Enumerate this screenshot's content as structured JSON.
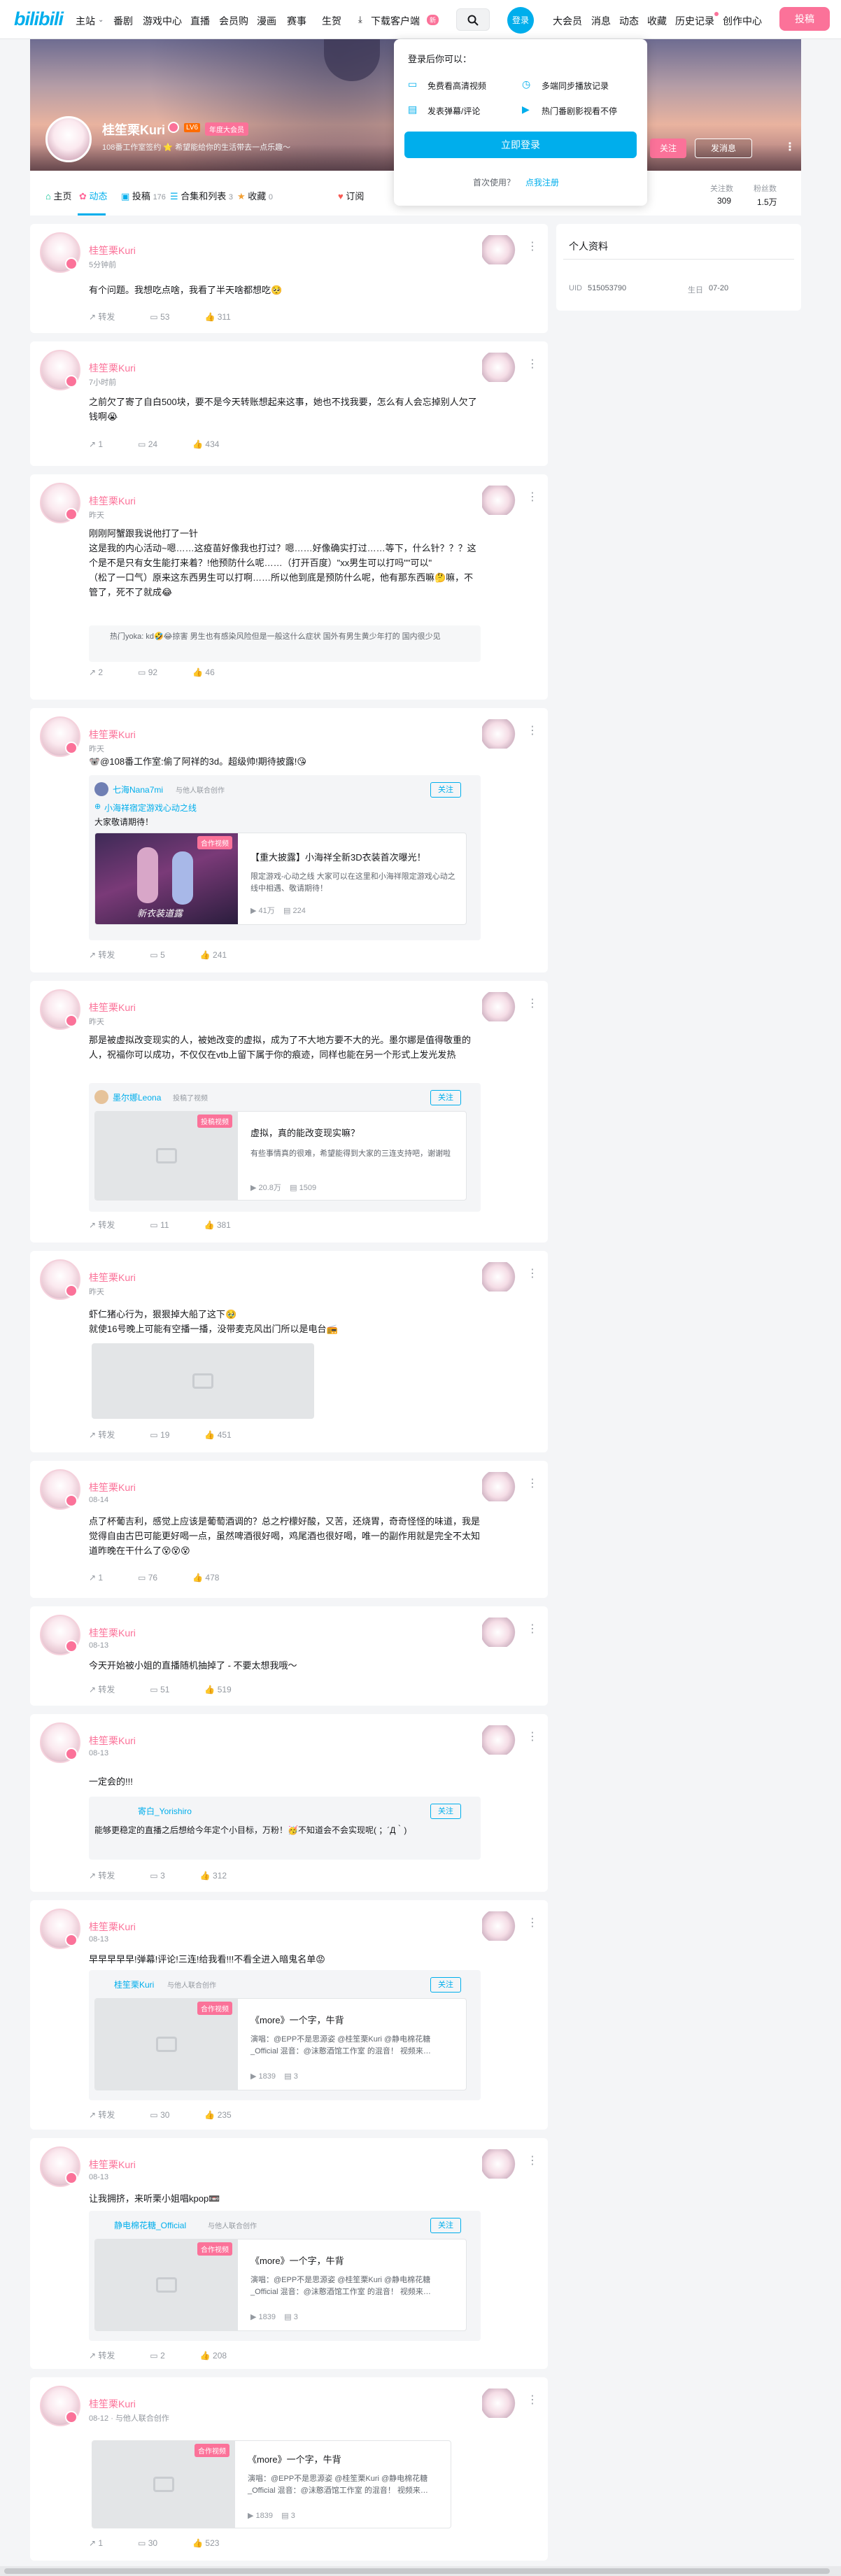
{
  "topbar": {
    "logo": "bilibili",
    "nav": [
      "主站",
      "番剧",
      "游戏中心",
      "直播",
      "会员购",
      "漫画",
      "赛事",
      "生贺",
      "下载客户端"
    ],
    "download_badge": "新",
    "login": "登录",
    "right": [
      "大会员",
      "消息",
      "动态",
      "收藏",
      "历史记录",
      "创作中心"
    ],
    "upload": "投稿"
  },
  "profile": {
    "name": "桂笙栗Kuri",
    "level": "LV6",
    "vip": "年度大会员",
    "sign": "108番工作室签约 ⭐ 希望能给你的生活带去一点乐趣～"
  },
  "popup": {
    "title": "登录后你可以：",
    "items": [
      "免费看高清视频",
      "多端同步播放记录",
      "发表弹幕/评论",
      "热门番剧影视看不停"
    ],
    "button": "立即登录",
    "first": "首次使用？",
    "register": "点我注册"
  },
  "banner": {
    "follow": "关注",
    "message": "发消息"
  },
  "tabs": {
    "home": "主页",
    "dynamic": "动态",
    "video": "投稿",
    "video_count": "176",
    "collect": "合集和列表",
    "collect_count": "3",
    "fav": "收藏",
    "fav_count": "0",
    "sub": "订阅"
  },
  "stats": {
    "follow_label": "关注数",
    "follow": "309",
    "fans_label": "粉丝数",
    "fans": "1.5万"
  },
  "side": {
    "title": "个人资料",
    "uid_label": "UID",
    "uid": "515053790",
    "birth_label": "生日",
    "birth": "07-20"
  },
  "posts": [
    {
      "name": "桂笙栗Kuri",
      "time": "5分钟前",
      "text": "有个问题。我想吃点啥，我看了半天啥都想吃🥺",
      "fwd": "转发",
      "cmt": "53",
      "like": "311"
    },
    {
      "name": "桂笙栗Kuri",
      "time": "7小时前",
      "text": "之前欠了寄了自白500块，要不是今天转账想起来这事，她也不找我要，怎么有人会忘掉别人欠了钱啊😭",
      "fwd": "1",
      "cmt": "24",
      "like": "434"
    },
    {
      "name": "桂笙栗Kuri",
      "time": "昨天",
      "text": "刚刚阿蟹跟我说他打了一针\n这是我的内心活动~嗯……这疫苗好像我也打过？嗯……好像确实打过……等下，什么针？？？这个是不是只有女生能打来着？!他预防什么呢……（打开百度）\"xx男生可以打吗\"\"可以\"\n（松了一口气）原来这东西男生可以打啊……所以他到底是预防什么呢，他有那东西嘛🤔嘛，不管了，死不了就成😂",
      "quote": "热门yoka: kd🤣😂掠害 男生也有感染风险但是一般这什么症状 国外有男生黄少年打的 国内很少见",
      "fwd": "2",
      "cmt": "92",
      "like": "46"
    },
    {
      "name": "桂笙栗Kuri",
      "time": "昨天",
      "text": "🐨@108番工作室:偷了阿祥的3d。超级帅!期待披露!😘",
      "card_user": "七海Nana7mi",
      "card_meta": "与他人联合创作",
      "topic": "小海祥宿定游戏心动之线",
      "card_text": "大家敬请期待！",
      "video_title": "【重大披露】小海祥全新3D衣装首次曝光！",
      "video_desc": "限定游戏-心动之线 大家可以在这里和小海祥限定游戏心动之线中相遇、敬请期待！",
      "video_views": "41万",
      "video_dm": "224",
      "cover_text": "新衣装道露",
      "video_badge": "合作视频",
      "fwd": "",
      "cmt": "5",
      "like": "241"
    },
    {
      "name": "桂笙栗Kuri",
      "time": "昨天",
      "text": "那是被虚拟改变现实的人，被她改变的虚拟，成为了不大地方要不大的光。墨尔娜是值得敬重的人，祝福你可以成功，不仅仅在vtb上留下属于你的痕迹，同样也能在另一个形式上发光发热",
      "card_user": "墨尔娜Leona",
      "card_meta": "投稿了视频",
      "video_title": "虚拟，真的能改变现实嘛？",
      "video_desc": "有些事情真的很难，希望能得到大家的三连支持吧，谢谢啦",
      "video_views": "20.8万",
      "video_dm": "1509",
      "video_badge": "投稿视频",
      "fwd": "",
      "cmt": "11",
      "like": "381"
    },
    {
      "name": "桂笙栗Kuri",
      "time": "昨天",
      "text": "虾仁猪心行为，狠狠掉大船了这下🥹\n就使16号晚上可能有空播一播，没带麦克风出门所以是电台📻",
      "fwd": "",
      "cmt": "19",
      "like": "451"
    },
    {
      "name": "桂笙栗Kuri",
      "time": "08-14",
      "text": "点了杯葡吉利，感觉上应该是葡萄酒调的？总之柠檬好酸，又苦，还烧胃，奇奇怪怪的味道，我是觉得自由古巴可能更好喝一点，虽然啤酒很好喝，鸡尾酒也很好喝，唯一的副作用就是完全不太知道昨晚在干什么了😵😵😵",
      "fwd": "1",
      "cmt": "76",
      "like": "478"
    },
    {
      "name": "桂笙栗Kuri",
      "time": "08-13",
      "text": "今天开始被小姐的直播随机抽掉了 - 不要太想我哦～",
      "fwd": "",
      "cmt": "51",
      "like": "519"
    },
    {
      "name": "桂笙栗Kuri",
      "time": "08-13",
      "text": "一定会的!!!",
      "card_user": "寄白_Yorishiro",
      "card_text": "能够更稳定的直播之后想给今年定个小目标，万粉！🥳不知道会不会实现呢( ；´Д｀)",
      "fwd": "",
      "cmt": "3",
      "like": "312"
    },
    {
      "name": "桂笙栗Kuri",
      "time": "08-13",
      "text": "早早早早早!弹幕!评论!三连!给我看!!!不看全进入暗鬼名单😡",
      "card_user": "桂笙栗Kuri",
      "card_meta": "与他人联合创作",
      "video_title": "《more》一个字，牛背",
      "video_desc": "演唱：@EPP不是思源姿 @桂笙栗Kuri @静电棉花糖_Official 混音：@沫憨酒馆工作室 的混音！ 视频来…",
      "video_views": "1839",
      "video_dm": "3",
      "video_badge": "合作视频",
      "fwd": "",
      "cmt": "30",
      "like": "235"
    },
    {
      "name": "桂笙栗Kuri",
      "time": "08-13",
      "text": "让我拥挤，来听栗小姐唱kpop📼",
      "card_user": "静电棉花糖_Official",
      "card_meta": "与他人联合创作",
      "video_title": "《more》一个字，牛背",
      "video_desc": "演唱：@EPP不是思源姿 @桂笙栗Kuri @静电棉花糖_Official 混音：@沫憨酒馆工作室 的混音！ 视频来…",
      "video_views": "1839",
      "video_dm": "3",
      "video_badge": "合作视频",
      "fwd": "",
      "cmt": "2",
      "like": "208"
    },
    {
      "name": "桂笙栗Kuri",
      "time": "08-12 · 与他人联合创作",
      "video_title": "《more》一个字，牛背",
      "video_desc": "演唱：@EPP不是思源姿 @桂笙栗Kuri @静电棉花糖_Official 混音：@沫憨酒馆工作室 的混音！ 视频来…",
      "video_views": "1839",
      "video_dm": "3",
      "video_badge": "合作视频",
      "fwd": "1",
      "cmt": "30",
      "like": "523"
    }
  ]
}
